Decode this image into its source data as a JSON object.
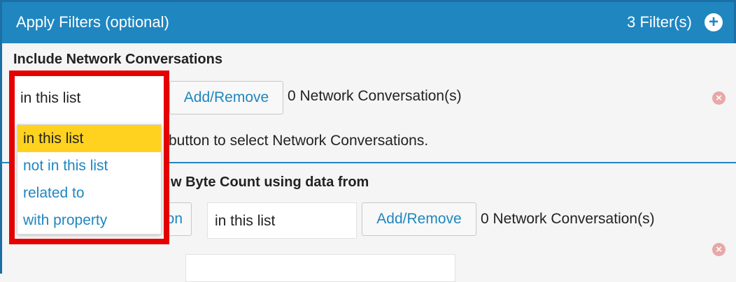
{
  "header": {
    "title": "Apply Filters (optional)",
    "filter_count": "3 Filter(s)",
    "add_icon": "plus-circle-icon"
  },
  "filter1": {
    "title": "Include Network Conversations",
    "select_value": "in this list",
    "add_remove_label": "Add/Remove",
    "count_text": "0 Network Conversation(s)",
    "hint": "button to select Network Conversations.",
    "remove_icon": "remove-circle-icon"
  },
  "dropdown": {
    "options": [
      "in this list",
      "not in this list",
      "related to",
      "with property"
    ],
    "selected_index": 0
  },
  "filter2": {
    "title_partial": "w Byte Count using data from",
    "button_partial": "on",
    "select_value": "in this list",
    "add_remove_label": "Add/Remove",
    "count_text": "0 Network Conversation(s)",
    "remove_icon": "remove-circle-icon"
  },
  "colors": {
    "header_bg": "#1f86c0",
    "highlight_border": "#e60000",
    "selected_option_bg": "#ffd21f",
    "link_blue": "#1f86c0"
  }
}
